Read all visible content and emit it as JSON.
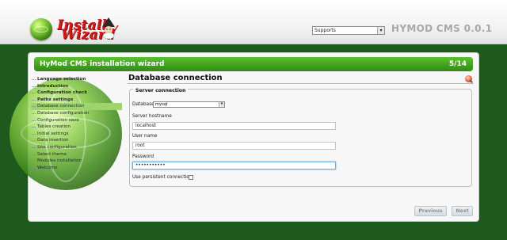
{
  "header": {
    "logo_line1": "Install",
    "logo_line2": "Wizard",
    "supports_select": {
      "selected": "Supports"
    },
    "app_version": "HYMOD CMS 0.0.1"
  },
  "panel": {
    "title": "HyMod CMS installation wizard",
    "step": "5/14"
  },
  "sidebar": {
    "items": [
      {
        "label": "Language selection",
        "state": "done"
      },
      {
        "label": "Introduction",
        "state": "done"
      },
      {
        "label": "Configuration check",
        "state": "done"
      },
      {
        "label": "Paths settings",
        "state": "done"
      },
      {
        "label": "Database connection",
        "state": "active"
      },
      {
        "label": "Database configuration",
        "state": "todo"
      },
      {
        "label": "Configuration save",
        "state": "todo"
      },
      {
        "label": "Tables creation",
        "state": "todo"
      },
      {
        "label": "Initial settings",
        "state": "todo"
      },
      {
        "label": "Data insertion",
        "state": "todo"
      },
      {
        "label": "Site configuration",
        "state": "todo"
      },
      {
        "label": "Select theme",
        "state": "todo"
      },
      {
        "label": "Modules installation",
        "state": "todo"
      },
      {
        "label": "Welcome",
        "state": "todo"
      }
    ]
  },
  "content": {
    "title": "Database connection",
    "fieldset_legend": "Server connection",
    "database_label": "Database",
    "database_value": "mysql",
    "hostname_label": "Server hostname",
    "hostname_value": "localhost",
    "username_label": "User name",
    "username_value": "root",
    "password_label": "Password",
    "password_value": "•••••••••••",
    "persistent_label": "Use persistent connection",
    "persistent_checked": false
  },
  "buttons": {
    "previous": "Previous",
    "next": "Next"
  },
  "colors": {
    "background": "#1e5a1e",
    "header_bar": "#3f9a1c",
    "active_item": "#9ed46b",
    "logo_text": "#d11a1a"
  }
}
